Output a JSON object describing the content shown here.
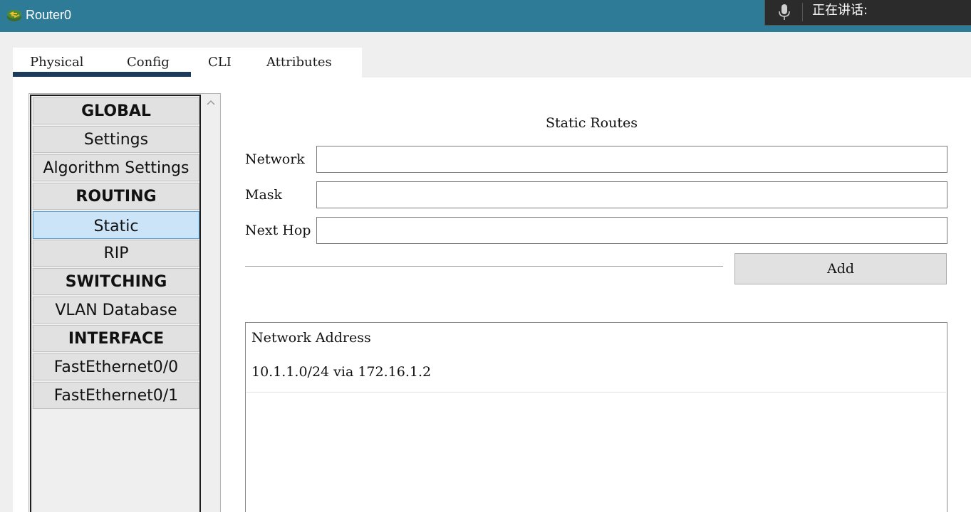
{
  "window": {
    "title": "Router0",
    "icon": "router-icon"
  },
  "voice_overlay": {
    "icon": "microphone-icon",
    "text": "正在讲话:"
  },
  "tabs": [
    {
      "label": "Physical"
    },
    {
      "label": "Config",
      "selected": true
    },
    {
      "label": "CLI"
    },
    {
      "label": "Attributes"
    }
  ],
  "sidebar": {
    "items": [
      {
        "label": "GLOBAL",
        "type": "header"
      },
      {
        "label": "Settings",
        "type": "item"
      },
      {
        "label": "Algorithm Settings",
        "type": "item"
      },
      {
        "label": "ROUTING",
        "type": "header"
      },
      {
        "label": "Static",
        "type": "item",
        "selected": true
      },
      {
        "label": "RIP",
        "type": "item"
      },
      {
        "label": "SWITCHING",
        "type": "header"
      },
      {
        "label": "VLAN Database",
        "type": "item"
      },
      {
        "label": "INTERFACE",
        "type": "header"
      },
      {
        "label": "FastEthernet0/0",
        "type": "item"
      },
      {
        "label": "FastEthernet0/1",
        "type": "item"
      }
    ]
  },
  "static_routes": {
    "title": "Static Routes",
    "fields": {
      "network": {
        "label": "Network",
        "value": ""
      },
      "mask": {
        "label": "Mask",
        "value": ""
      },
      "next_hop": {
        "label": "Next Hop",
        "value": ""
      }
    },
    "add_label": "Add",
    "list_header": "Network Address",
    "routes": [
      "10.1.1.0/24 via 172.16.1.2"
    ]
  },
  "colors": {
    "titlebar": "#2e7b98",
    "tab_underline": "#1b3a5c",
    "selected_item": "#cce4f7"
  }
}
